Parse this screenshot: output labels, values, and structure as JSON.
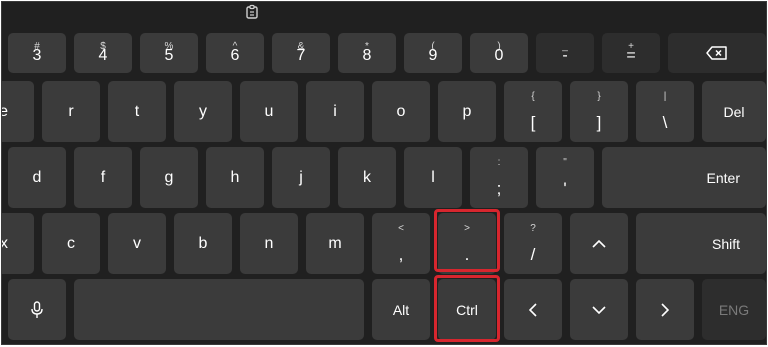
{
  "keyboard": {
    "row1": [
      {
        "sec": "#",
        "main": "3"
      },
      {
        "sec": "$",
        "main": "4"
      },
      {
        "sec": "%",
        "main": "5"
      },
      {
        "sec": "^",
        "main": "6"
      },
      {
        "sec": "&",
        "main": "7"
      },
      {
        "sec": "*",
        "main": "8"
      },
      {
        "sec": "(",
        "main": "9"
      },
      {
        "sec": ")",
        "main": "0"
      },
      {
        "sec": "_",
        "main": "-"
      },
      {
        "sec": "+",
        "main": "="
      }
    ],
    "row2": [
      {
        "main": "e"
      },
      {
        "main": "r"
      },
      {
        "main": "t"
      },
      {
        "main": "y"
      },
      {
        "main": "u"
      },
      {
        "main": "i"
      },
      {
        "main": "o"
      },
      {
        "main": "p"
      },
      {
        "sec": "{",
        "main": "["
      },
      {
        "sec": "}",
        "main": "]"
      },
      {
        "sec": "|",
        "main": "\\"
      }
    ],
    "row3": [
      {
        "main": "d"
      },
      {
        "main": "f"
      },
      {
        "main": "g"
      },
      {
        "main": "h"
      },
      {
        "main": "j"
      },
      {
        "main": "k"
      },
      {
        "main": "l"
      },
      {
        "sec": ":",
        "main": ";"
      },
      {
        "sec": "\"",
        "main": "'"
      }
    ],
    "row4": [
      {
        "main": "x"
      },
      {
        "main": "c"
      },
      {
        "main": "v"
      },
      {
        "main": "b"
      },
      {
        "main": "n"
      },
      {
        "main": "m"
      },
      {
        "sec": "<",
        "main": ","
      },
      {
        "sec": ">",
        "main": "."
      },
      {
        "sec": "?",
        "main": "/"
      }
    ],
    "labels": {
      "del": "Del",
      "enter": "Enter",
      "shift": "Shift",
      "alt": "Alt",
      "ctrl": "Ctrl",
      "lang": "ENG"
    },
    "icons": {
      "top": "clipboard-icon",
      "backspace": "backspace-icon",
      "up": "chevron-up-icon",
      "left": "chevron-left-icon",
      "down": "chevron-down-icon",
      "right": "chevron-right-icon",
      "mic": "microphone-icon"
    },
    "colors": {
      "key": "#3b3b3b",
      "background": "#202020",
      "highlight": "#d7262e"
    }
  }
}
